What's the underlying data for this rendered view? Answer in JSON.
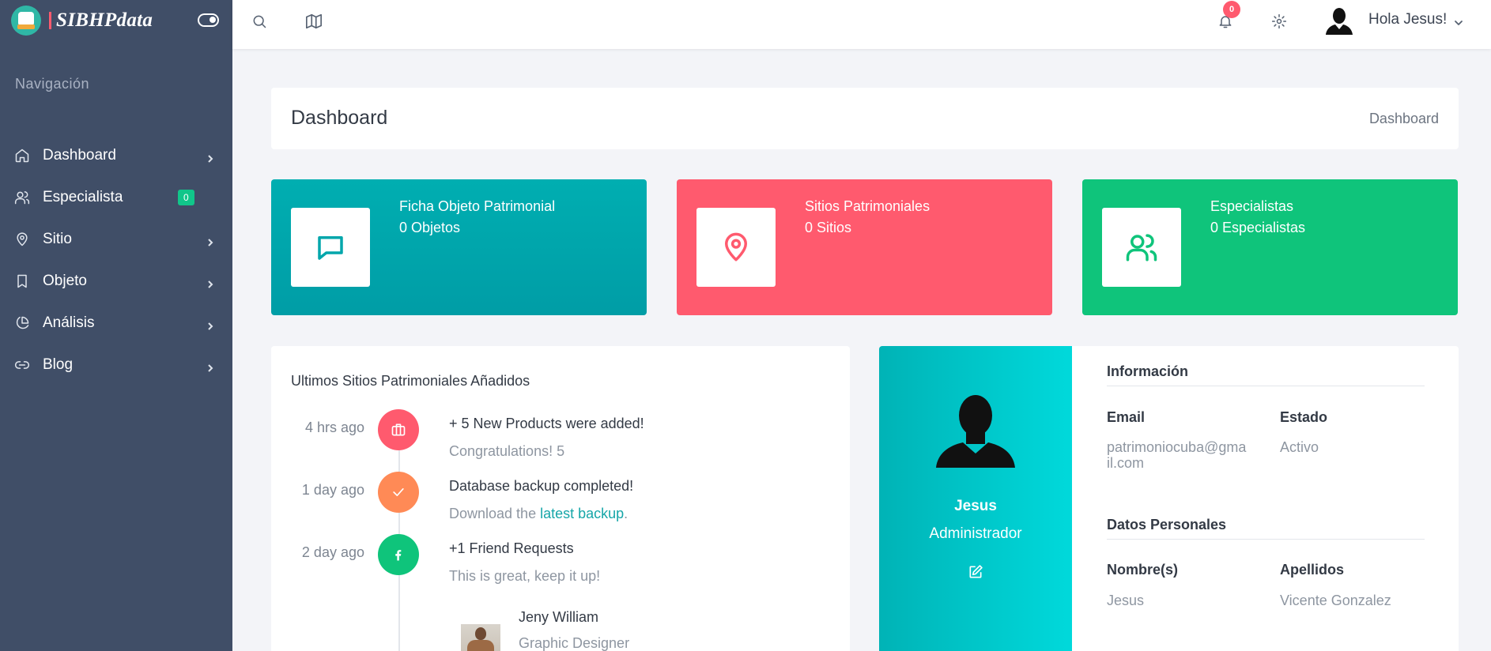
{
  "brand": {
    "name": "SIBHPdata"
  },
  "sidebar": {
    "heading": "Navigación",
    "items": [
      {
        "label": "Dashboard",
        "icon": "home-icon",
        "chevron": true
      },
      {
        "label": "Especialista",
        "icon": "users-icon",
        "badge": "0"
      },
      {
        "label": "Sitio",
        "icon": "map-pin-icon",
        "chevron": true
      },
      {
        "label": "Objeto",
        "icon": "bookmark-icon",
        "chevron": true
      },
      {
        "label": "Análisis",
        "icon": "pie-chart-icon",
        "chevron": true
      },
      {
        "label": "Blog",
        "icon": "link-icon",
        "chevron": true
      }
    ]
  },
  "topbar": {
    "notifications_count": "0",
    "greeting": "Hola Jesus!"
  },
  "page": {
    "title": "Dashboard",
    "breadcrumb": "Dashboard"
  },
  "stats": [
    {
      "title": "Ficha Objeto Patrimonial",
      "value": "0 Objetos",
      "color": "#00aeb1",
      "icon": "message-square-icon"
    },
    {
      "title": "Sitios Patrimoniales",
      "value": "0 Sitios",
      "color": "#ff5a6e",
      "icon": "map-pin-icon"
    },
    {
      "title": "Especialistas",
      "value": "0 Especialistas",
      "color": "#0fc47b",
      "icon": "users-icon"
    }
  ],
  "timeline": {
    "title": "Ultimos Sitios Patrimoniales Añadidos",
    "events": [
      {
        "time": "4 hrs ago",
        "heading": "+ 5 New Products were added!",
        "sub": "Congratulations! 5",
        "color": "#ff5a6e",
        "icon": "briefcase-icon"
      },
      {
        "time": "1 day ago",
        "heading": "Database backup completed!",
        "sub_prefix": "Download the ",
        "link": "latest backup",
        "sub_suffix": ".",
        "color": "#ff8a56",
        "icon": "check-icon"
      },
      {
        "time": "2 day ago",
        "heading": "+1 Friend Requests",
        "sub": "This is great, keep it up!",
        "color": "#0fc47b",
        "icon": "facebook-icon"
      }
    ],
    "person": {
      "name": "Jeny William",
      "role": "Graphic Designer"
    }
  },
  "profile": {
    "name": "Jesus",
    "role": "Administrador",
    "info_title": "Información",
    "email_label": "Email",
    "email_value_line1": "patrimoniocuba@gma",
    "email_value_line2": "il.com",
    "status_label": "Estado",
    "status_value": "Activo",
    "personal_title": "Datos Personales",
    "first_label": "Nombre(s)",
    "first_value": "Jesus",
    "last_label": "Apellidos",
    "last_value": "Vicente Gonzalez"
  }
}
